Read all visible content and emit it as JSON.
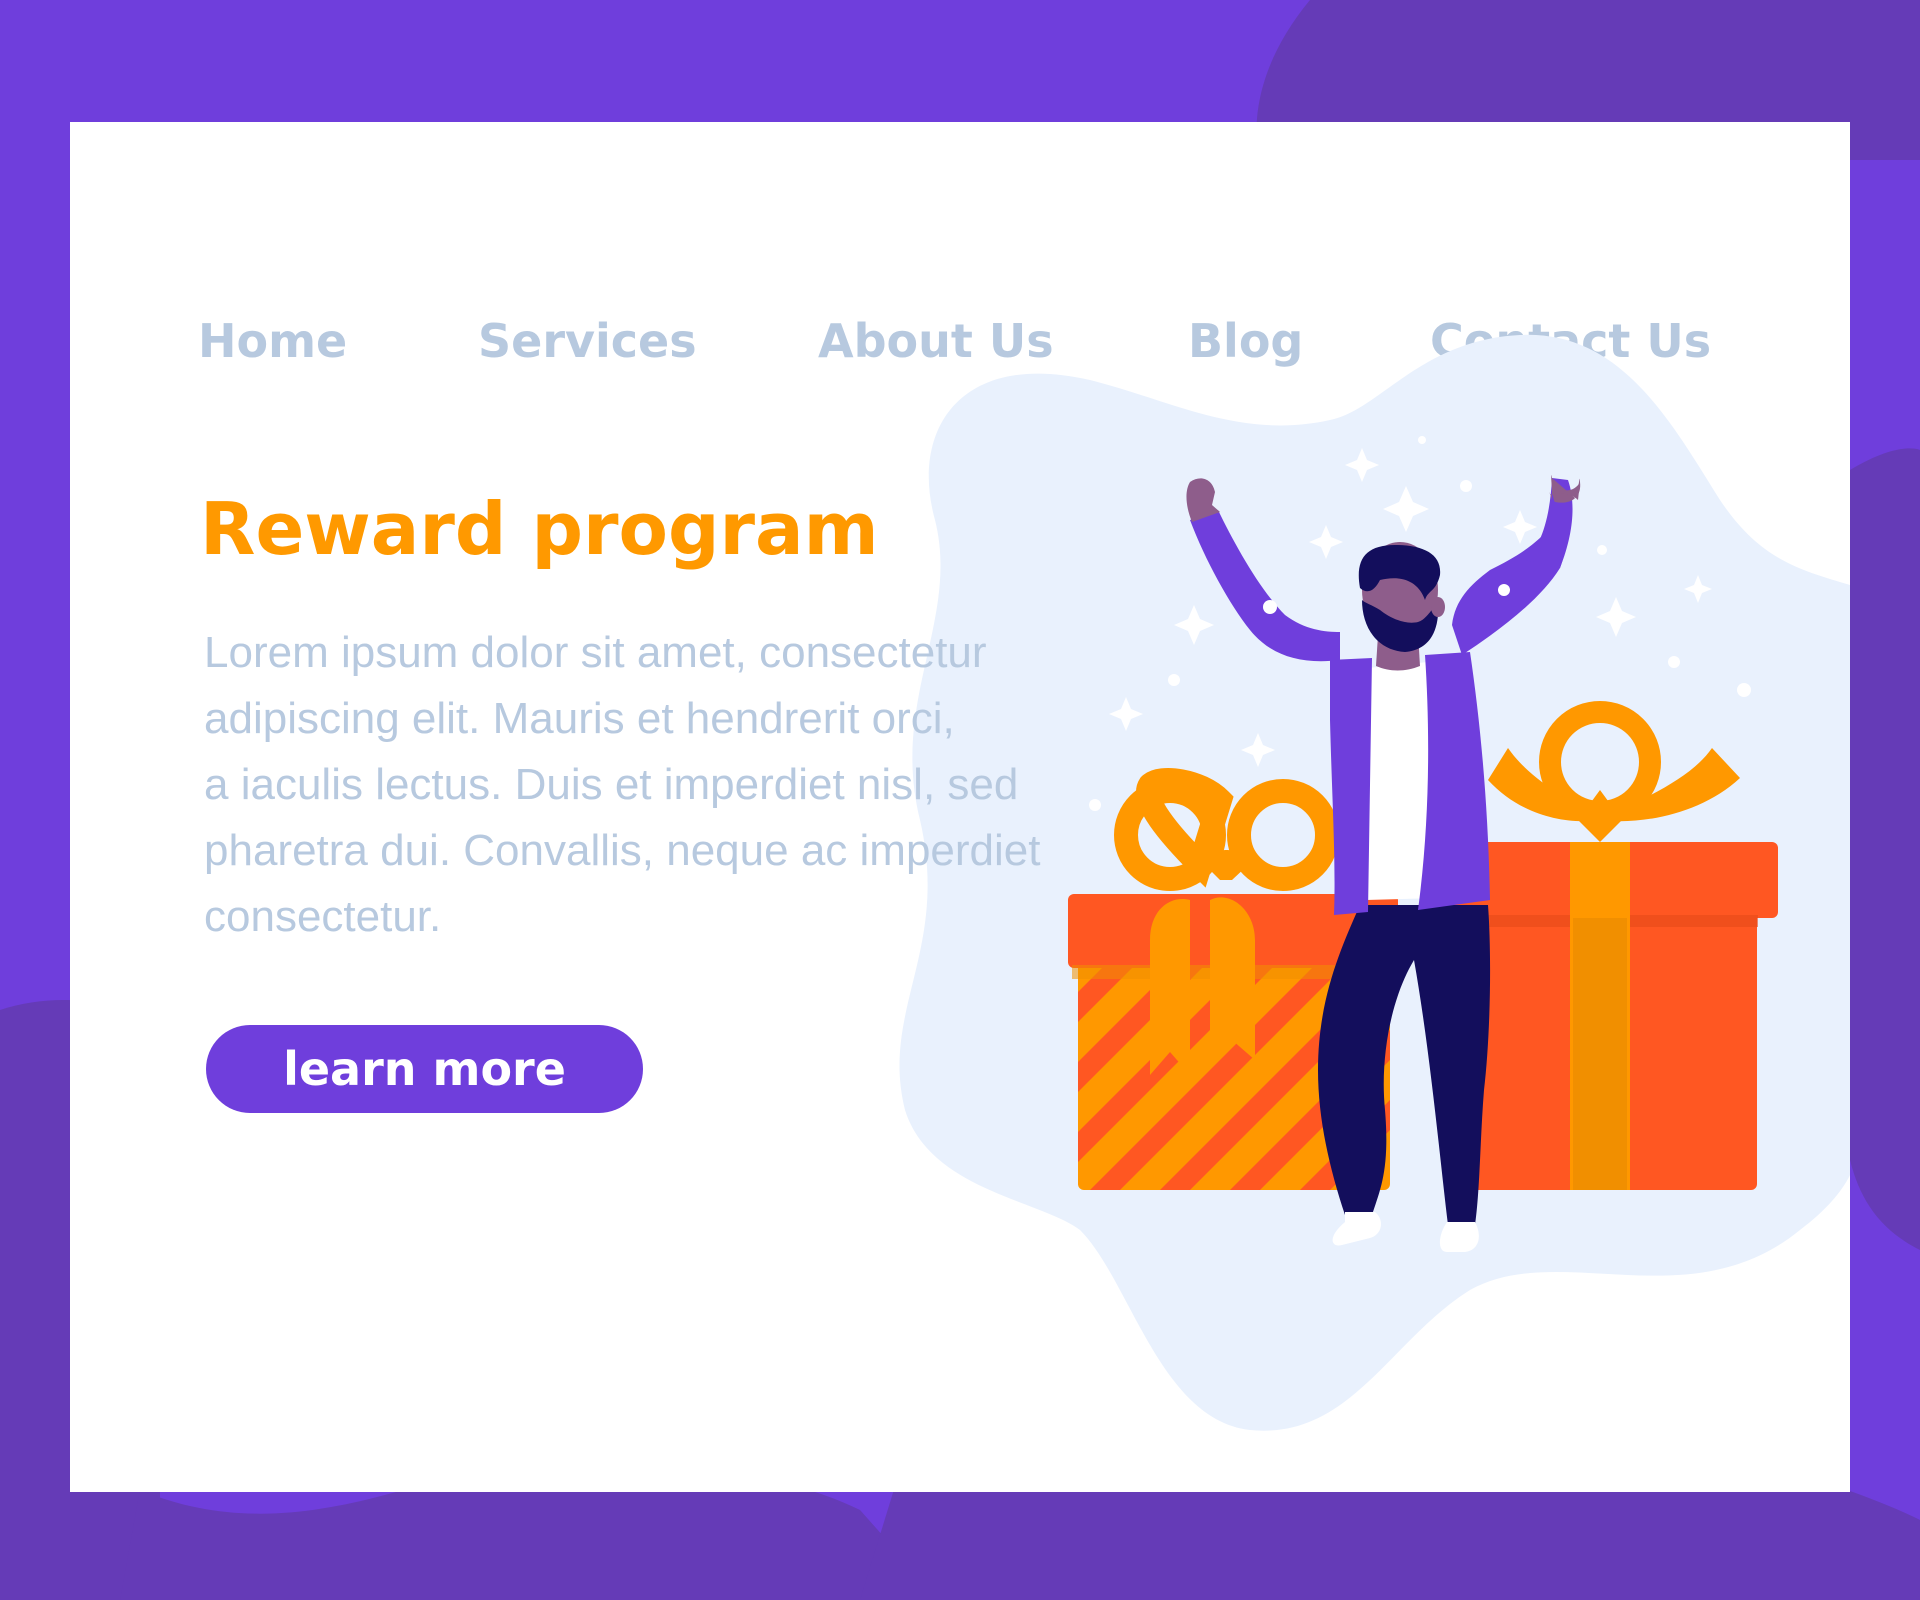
{
  "nav": {
    "items": [
      {
        "label": "Home"
      },
      {
        "label": "Services"
      },
      {
        "label": "About Us"
      },
      {
        "label": "Blog"
      },
      {
        "label": "Contact Us"
      }
    ]
  },
  "hero": {
    "title": "Reward program",
    "body_lines": [
      "Lorem ipsum dolor sit amet, consectetur",
      "adipiscing elit. Mauris et hendrerit orci,",
      "a iaculis lectus. Duis et imperdiet nisl, sed",
      "pharetra dui. Convallis, neque ac imperdiet",
      "consectetur."
    ],
    "cta_label": "learn more"
  },
  "illustration": {
    "subject": "man celebrating with arms raised between two gift boxes",
    "icons": [
      "gift-box-icon",
      "sparkle-icon",
      "person-celebrating-icon"
    ]
  },
  "colors": {
    "background_purple": "#6f3edc",
    "card": "#ffffff",
    "nav_text": "#b7c9df",
    "title_orange": "#ff9900",
    "body_text": "#b7c9df",
    "button": "#6f3edc",
    "gift_red": "#ff5722",
    "ribbon_orange": "#ff9800",
    "blob_light": "#e9f1fd"
  }
}
